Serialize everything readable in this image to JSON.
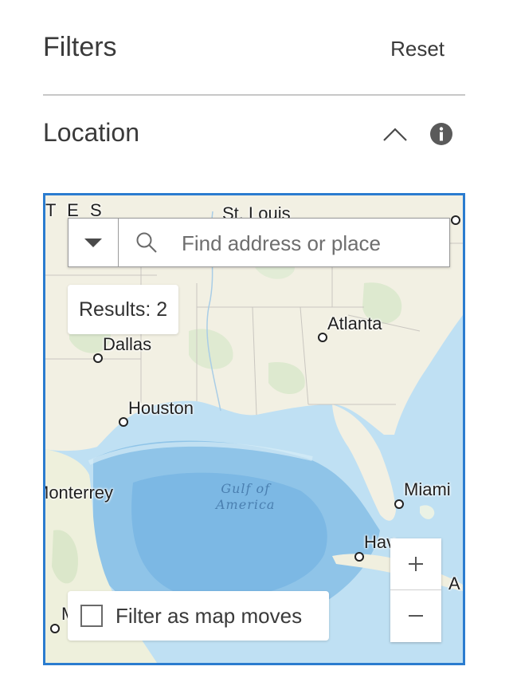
{
  "header": {
    "title": "Filters",
    "reset_label": "Reset"
  },
  "section": {
    "title": "Location",
    "expanded": true
  },
  "map": {
    "search_placeholder": "Find address or place",
    "results_label": "Results: 2",
    "filter_label": "Filter as map moves",
    "filter_checked": false,
    "water_label": {
      "line1": "Gulf of",
      "line2": "America"
    },
    "cities": {
      "stlouis": "St. Louis",
      "atlanta": "Atlanta",
      "dallas": "Dallas",
      "houston": "Houston",
      "monterrey": "Monterrey",
      "miami": "Miami",
      "havana": "Hav",
      "states": "T E S",
      "letter_a": "A",
      "letter_m": "M"
    }
  },
  "colors": {
    "accent": "#2b7ccf",
    "water": "#b9daf0",
    "land": "#f2f0e6"
  }
}
